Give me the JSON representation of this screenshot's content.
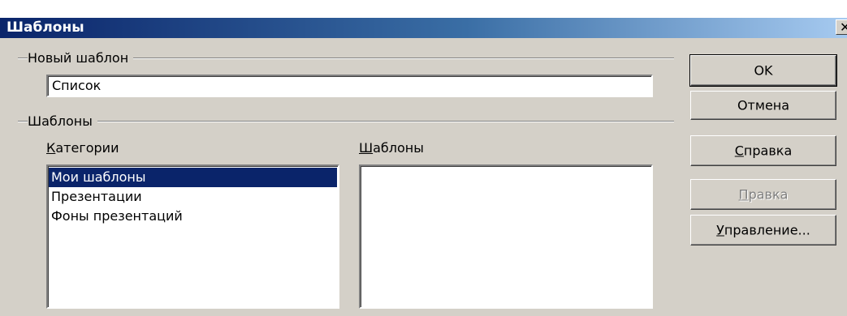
{
  "window": {
    "title": "Шаблоны",
    "close_glyph": "✕"
  },
  "new_template": {
    "group_label": "Новый шаблон",
    "value": "Список"
  },
  "templates_group": {
    "group_label": "Шаблоны",
    "categories": {
      "accesskey": "К",
      "label_rest": "атегории",
      "items": [
        {
          "label": "Мои шаблоны",
          "selected": true
        },
        {
          "label": "Презентации",
          "selected": false
        },
        {
          "label": "Фоны презентаций",
          "selected": false
        }
      ]
    },
    "templates": {
      "accesskey": "Ш",
      "label_rest": "аблоны",
      "items": []
    }
  },
  "buttons": {
    "ok": {
      "label": "OK"
    },
    "cancel": {
      "label": "Отмена"
    },
    "help": {
      "accesskey": "С",
      "label_rest": "правка",
      "enabled": true
    },
    "edit": {
      "accesskey": "П",
      "label_rest": "равка",
      "enabled": false
    },
    "manage": {
      "accesskey": "У",
      "label_rest": "правление...",
      "enabled": true
    }
  },
  "colors": {
    "dialog_bg": "#d4d0c8",
    "title_gradient_start": "#0a246a",
    "title_gradient_end": "#a6caf0",
    "selection_bg": "#0a246a",
    "selection_text": "#ffffff"
  }
}
